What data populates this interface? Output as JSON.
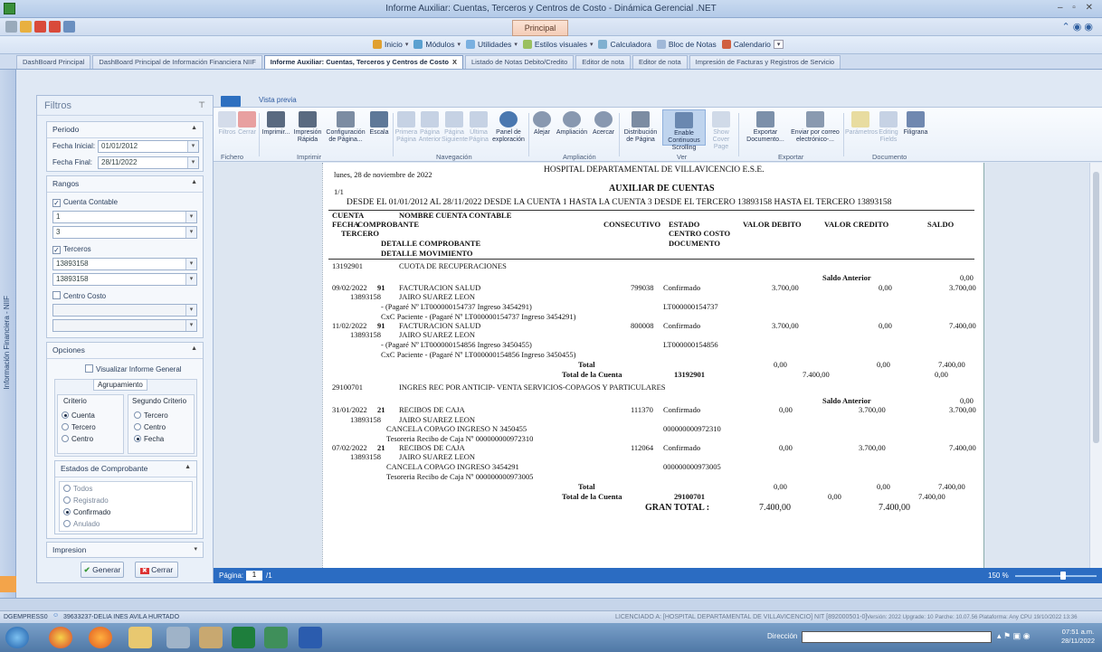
{
  "window": {
    "title": "Informe Auxiliar: Cuentas, Terceros y Centros de Costo - Dinámica Gerencial .NET",
    "controls": "– ▫ ✕"
  },
  "ribbon_tab": "Principal",
  "menu": [
    {
      "label": "Inicio"
    },
    {
      "label": "Módulos"
    },
    {
      "label": "Utilidades"
    },
    {
      "label": "Estilos visuales"
    },
    {
      "label": "Calculadora"
    },
    {
      "label": "Bloc de Notas"
    },
    {
      "label": "Calendario"
    }
  ],
  "doc_tabs": [
    {
      "label": "DashBoard Principal"
    },
    {
      "label": "DashBoard Principal de Información Financiera NIIF"
    },
    {
      "label": "Informe Auxiliar: Cuentas, Terceros y Centros de Costo",
      "close": "X"
    },
    {
      "label": "Listado de Notas Debito/Credito"
    },
    {
      "label": "Editor de nota"
    },
    {
      "label": "Editor de nota"
    },
    {
      "label": "Impresión de Facturas y Registros de Servicio"
    }
  ],
  "side_label": "Información Financiera - NIIF",
  "filters": {
    "title": "Filtros",
    "periodo": {
      "title": "Periodo",
      "fecha_inicial_label": "Fecha Inicial:",
      "fecha_inicial": "01/01/2012",
      "fecha_final_label": "Fecha Final:",
      "fecha_final": "28/11/2022"
    },
    "rangos": {
      "title": "Rangos",
      "cuenta_contable": "Cuenta Contable",
      "cuenta_desde": "1",
      "cuenta_hasta": "3",
      "terceros": "Terceros",
      "tercero_desde": "13893158",
      "tercero_hasta": "13893158",
      "centro_costo": "Centro Costo"
    },
    "opciones": {
      "title": "Opciones",
      "visualizar": "Visualizar Informe General",
      "agrupamiento": "Agrupamiento",
      "criterio": "Criterio",
      "segundo_criterio": "Segundo Criterio",
      "c1": [
        "Cuenta",
        "Tercero",
        "Centro"
      ],
      "c2": [
        "Tercero",
        "Centro",
        "Fecha"
      ]
    },
    "estados": {
      "title": "Estados de Comprobante",
      "items": [
        "Todos",
        "Registrado",
        "Confirmado",
        "Anulado"
      ]
    },
    "impresion": "Impresion",
    "generar": "Generar",
    "cerrar": "Cerrar"
  },
  "preview": {
    "tab": "Vista previa",
    "buttons": {
      "filtros": "Filtros",
      "cerrar": "Cerrar",
      "imprimir": "Imprimir...",
      "impresion_rapida": "Impresión Rápida",
      "configuracion": "Configuración de Página...",
      "escala": "Escala",
      "primera": "Primera Página",
      "anterior": "Página Anterior",
      "siguiente": "Página Siguiente",
      "ultima": "Última Página",
      "panel": "Panel de exploración",
      "alejar": "Alejar",
      "ampliacion": "Ampliación",
      "acercar": "Acercar",
      "distribucion": "Distribución de Página",
      "continuous": "Enable Continuous Scrolling",
      "cover": "Show Cover Page",
      "exportar": "Exportar Documento...",
      "enviar": "Enviar por correo electrónico-...",
      "parametros": "Parámetros",
      "editing": "Editing Fields",
      "filigrana": "Filigrana"
    },
    "groups": {
      "fichero": "Fichero",
      "imprimir": "Imprimir",
      "navegacion": "Navegación",
      "ampliacion": "Ampliación",
      "ver": "Ver",
      "exportar": "Exportar",
      "documento": "Documento"
    },
    "status": {
      "pagina_label": "Página:",
      "pagina": "1",
      "total": "/1",
      "zoom": "150 %"
    }
  },
  "report": {
    "fecha": "lunes, 28 de noviembre de 2022",
    "hospital": "HOSPITAL DEPARTAMENTAL DE VILLAVICENCIO E.S.E.",
    "pagina": "1/1",
    "titulo": "AUXILIAR DE CUENTAS",
    "subtitulo": "DESDE EL 01/01/2012 AL 28/11/2022 DESDE LA CUENTA 1 HASTA LA CUENTA 3 DESDE EL TERCERO 13893158 HASTA EL TERCERO 13893158",
    "headers": {
      "cuenta": "CUENTA",
      "nombre": "NOMBRE CUENTA CONTABLE",
      "fecha": "FECHA",
      "comprobante": "COMPROBANTE",
      "consecutivo": "CONSECUTIVO",
      "estado": "ESTADO",
      "valor_debito": "VALOR DEBITO",
      "valor_credito": "VALOR CREDITO",
      "saldo": "SALDO",
      "tercero": "TERCERO",
      "centro_costo": "CENTRO COSTO",
      "detalle_comprobante": "DETALLE COMPROBANTE",
      "documento": "DOCUMENTO",
      "detalle_movimiento": "DETALLE MOVIMIENTO"
    },
    "acc1": {
      "codigo": "13192901",
      "nombre": "CUOTA DE RECUPERACIONES",
      "saldo_anterior_label": "Saldo Anterior",
      "saldo_anterior": "0,00",
      "m1": {
        "fecha": "09/02/2022",
        "tipo": "91",
        "desc": "FACTURACION SALUD",
        "consec": "799038",
        "estado": "Confirmado",
        "debito": "3.700,00",
        "credito": "0,00",
        "saldo": "3.700,00",
        "tercero": "13893158",
        "nombre": "JAIRO  SUAREZ LEON",
        "detalle": "- (Pagaré Nº LT000000154737 Ingreso 3454291)",
        "doc": "LT000000154737",
        "mov": "CxC Paciente - (Pagaré Nº LT000000154737 Ingreso 3454291)"
      },
      "m2": {
        "fecha": "11/02/2022",
        "tipo": "91",
        "desc": "FACTURACION SALUD",
        "consec": "800008",
        "estado": "Confirmado",
        "debito": "3.700,00",
        "credito": "0,00",
        "saldo": "7.400,00",
        "tercero": "13893158",
        "nombre": "JAIRO  SUAREZ LEON",
        "detalle": "- (Pagaré Nº LT000000154856 Ingreso 3450455)",
        "doc": "LT000000154856",
        "mov": "CxC Paciente - (Pagaré Nº LT000000154856 Ingreso 3450455)"
      },
      "total_label": "Total",
      "total_debito": "0,00",
      "total_credito": "0,00",
      "total_saldo": "7.400,00",
      "tc_label": "Total de la Cuenta",
      "tc_cuenta": "13192901",
      "tc_debito": "7.400,00",
      "tc_credito": "0,00"
    },
    "acc2": {
      "codigo": "29100701",
      "nombre": "INGRES REC POR ANTICIP- VENTA  SERVICIOS-COPAGOS Y PARTICULARES",
      "saldo_anterior_label": "Saldo Anterior",
      "saldo_anterior": "0,00",
      "m1": {
        "fecha": "31/01/2022",
        "tipo": "21",
        "desc": "RECIBOS DE CAJA",
        "consec": "111370",
        "estado": "Confirmado",
        "debito": "0,00",
        "credito": "3.700,00",
        "saldo": "3.700,00",
        "tercero": "13893158",
        "nombre": "JAIRO  SUAREZ LEON",
        "detalle": "CANCELA COPAGO INGRESO  N  3450455",
        "doc": "000000000972310",
        "mov": "Tesoreria Recibo de Caja Nº 000000000972310"
      },
      "m2": {
        "fecha": "07/02/2022",
        "tipo": "21",
        "desc": "RECIBOS DE CAJA",
        "consec": "112064",
        "estado": "Confirmado",
        "debito": "0,00",
        "credito": "3.700,00",
        "saldo": "7.400,00",
        "tercero": "13893158",
        "nombre": "JAIRO  SUAREZ LEON",
        "detalle": "CANCELA COPAGO INGRESO 3454291",
        "doc": "000000000973005",
        "mov": "Tesoreria Recibo de Caja Nº 000000000973005"
      },
      "total_label": "Total",
      "total_debito": "0,00",
      "total_credito": "0,00",
      "total_saldo": "7.400,00",
      "tc_label": "Total de la Cuenta",
      "tc_cuenta": "29100701",
      "tc_debito": "0,00",
      "tc_credito": "7.400,00"
    },
    "gran_total_label": "GRAN TOTAL :",
    "gran_debito": "7.400,00",
    "gran_credito": "7.400,00"
  },
  "statusline": {
    "server": "DGEMPRESS0",
    "user": "39633237-DELIA INES AVILA HURTADO",
    "licencia": "LICENCIADO A: [HOSPITAL DEPARTAMENTAL DE VILLAVICENCIO] NIT [892000501-0]",
    "version": "Versión: 2022 Upgrade: 10 Parche: 10.07.56 Plataforma: Any CPU  19/10/2022 13:36"
  },
  "taskbar": {
    "direccion": "Dirección",
    "time": "07:51 a.m.",
    "date": "28/11/2022"
  }
}
